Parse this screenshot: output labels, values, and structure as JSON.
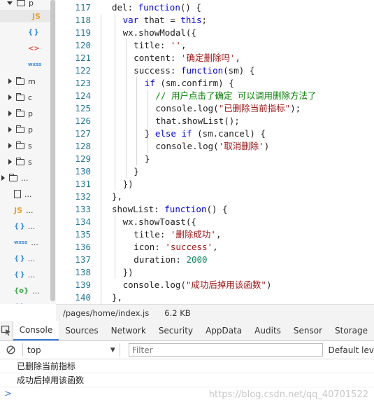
{
  "tree": {
    "items": [
      {
        "type": "folder-open",
        "label": "p"
      },
      {
        "type": "js",
        "label": "JS"
      },
      {
        "type": "json",
        "label": "{}"
      },
      {
        "type": "tag",
        "label": "<>"
      },
      {
        "type": "wxss",
        "label": "wxss"
      },
      {
        "type": "folder",
        "label": "m"
      },
      {
        "type": "folder",
        "label": "c"
      },
      {
        "type": "folder",
        "label": "p"
      },
      {
        "type": "folder",
        "label": "p"
      },
      {
        "type": "folder",
        "label": "s"
      },
      {
        "type": "folder",
        "label": "s"
      },
      {
        "type": "folder",
        "label": "..."
      },
      {
        "type": "file",
        "label": "..."
      },
      {
        "type": "js",
        "label": "..."
      },
      {
        "type": "json",
        "label": "..."
      },
      {
        "type": "wxss",
        "label": "..."
      },
      {
        "type": "json",
        "label": "..."
      },
      {
        "type": "json",
        "label": "..."
      },
      {
        "type": "comp",
        "label": "..."
      },
      {
        "type": "json",
        "label": "..."
      }
    ]
  },
  "editor": {
    "lines": [
      {
        "n": "117",
        "tokens": [
          [
            "t",
            "del: "
          ],
          [
            "kw",
            "function"
          ],
          [
            "t",
            "() {"
          ]
        ]
      },
      {
        "n": "118",
        "tokens": [
          [
            "kw",
            "var"
          ],
          [
            "t",
            " that = "
          ],
          [
            "kw",
            "this"
          ],
          [
            "t",
            ";"
          ]
        ]
      },
      {
        "n": "119",
        "tokens": [
          [
            "t",
            "wx.showModal({"
          ]
        ]
      },
      {
        "n": "120",
        "tokens": [
          [
            "t",
            "title: "
          ],
          [
            "str",
            "''"
          ],
          [
            "t",
            ","
          ]
        ]
      },
      {
        "n": "121",
        "tokens": [
          [
            "t",
            "content: "
          ],
          [
            "str",
            "'确定删除吗'"
          ],
          [
            "t",
            ","
          ]
        ]
      },
      {
        "n": "122",
        "tokens": [
          [
            "t",
            "success: "
          ],
          [
            "kw",
            "function"
          ],
          [
            "t",
            "(sm) {"
          ]
        ]
      },
      {
        "n": "123",
        "tokens": [
          [
            "kw",
            "if"
          ],
          [
            "t",
            " (sm.confirm) {"
          ]
        ]
      },
      {
        "n": "124",
        "tokens": [
          [
            "cmt",
            "// 用户点击了确定 可以调用删除方法了"
          ]
        ]
      },
      {
        "n": "125",
        "tokens": [
          [
            "t",
            "console.log("
          ],
          [
            "str",
            "\"已删除当前指标\""
          ],
          [
            "t",
            ");"
          ]
        ]
      },
      {
        "n": "126",
        "tokens": [
          [
            "t",
            "that.showList();"
          ]
        ]
      },
      {
        "n": "127",
        "tokens": [
          [
            "t",
            "} "
          ],
          [
            "kw",
            "else if"
          ],
          [
            "t",
            " (sm.cancel) {"
          ]
        ]
      },
      {
        "n": "128",
        "tokens": [
          [
            "t",
            "console.log("
          ],
          [
            "str",
            "'取消删除'"
          ],
          [
            "t",
            ")"
          ]
        ]
      },
      {
        "n": "129",
        "tokens": [
          [
            "t",
            "}"
          ]
        ]
      },
      {
        "n": "130",
        "tokens": [
          [
            "t",
            "}"
          ]
        ]
      },
      {
        "n": "131",
        "tokens": [
          [
            "t",
            "})"
          ]
        ]
      },
      {
        "n": "132",
        "tokens": [
          [
            "t",
            "},"
          ]
        ]
      },
      {
        "n": "133",
        "tokens": [
          [
            "t",
            "showList: "
          ],
          [
            "kw",
            "function"
          ],
          [
            "t",
            "() {"
          ]
        ]
      },
      {
        "n": "134",
        "tokens": [
          [
            "t",
            "wx.showToast({"
          ]
        ]
      },
      {
        "n": "135",
        "tokens": [
          [
            "t",
            "title: "
          ],
          [
            "str",
            "'删除成功'"
          ],
          [
            "t",
            ","
          ]
        ]
      },
      {
        "n": "136",
        "tokens": [
          [
            "t",
            "icon: "
          ],
          [
            "str",
            "'success'"
          ],
          [
            "t",
            ","
          ]
        ]
      },
      {
        "n": "137",
        "tokens": [
          [
            "t",
            "duration: "
          ],
          [
            "num",
            "2000"
          ]
        ]
      },
      {
        "n": "138",
        "tokens": [
          [
            "t",
            "})"
          ]
        ]
      },
      {
        "n": "139",
        "tokens": [
          [
            "t",
            "console.log("
          ],
          [
            "str",
            "\"成功后掉用该函数\""
          ],
          [
            "t",
            ")"
          ]
        ]
      },
      {
        "n": "140",
        "tokens": [
          [
            "t",
            "},"
          ]
        ]
      }
    ]
  },
  "statusbar": {
    "path": "/pages/home/index.js",
    "size": "6.2 KB"
  },
  "devtools": {
    "tabs": [
      "Console",
      "Sources",
      "Network",
      "Security",
      "AppData",
      "Audits",
      "Sensor",
      "Storage"
    ],
    "active_tab": "Console",
    "context": "top",
    "filter_placeholder": "Filter",
    "levels": "Default lev"
  },
  "console": {
    "messages": [
      "已删除当前指标",
      "成功后掉用该函数"
    ],
    "prompt": ">"
  },
  "watermark": "https://blog.csdn.net/qq_40701522"
}
